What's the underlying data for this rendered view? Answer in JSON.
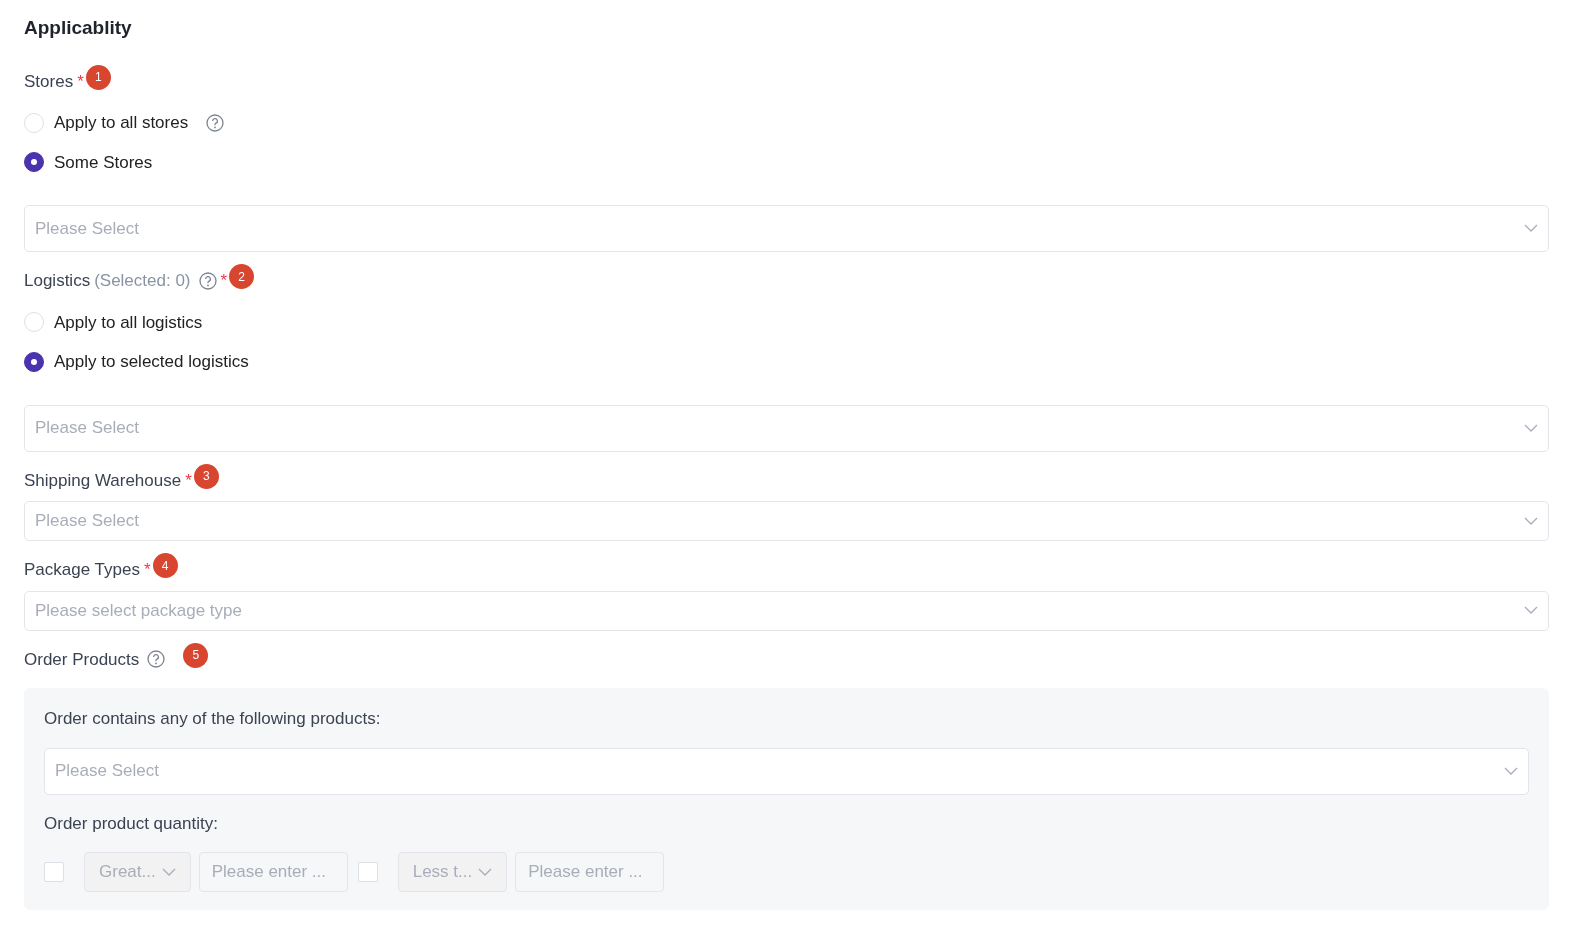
{
  "heading": "Applicablity",
  "sections": [
    {
      "kind": "radios",
      "label": "Stores",
      "help": false,
      "required": "*",
      "badge": "1",
      "options": [
        {
          "label": "Apply to all stores",
          "help": true,
          "selected": false
        },
        {
          "label": "Some Stores",
          "help": false,
          "selected": true
        }
      ],
      "select": {
        "placeholder": "Please Select"
      }
    },
    {
      "kind": "radios",
      "label": "Logistics",
      "note": "(Selected: 0)",
      "help": true,
      "required": "*",
      "badge": "2",
      "options": [
        {
          "label": "Apply to all logistics",
          "help": false,
          "selected": false
        },
        {
          "label": "Apply to selected logistics",
          "help": false,
          "selected": true
        }
      ],
      "select": {
        "placeholder": "Please Select"
      }
    },
    {
      "kind": "select",
      "label": "Shipping Warehouse",
      "help": false,
      "required": "*",
      "badge": "3",
      "select": {
        "placeholder": "Please Select"
      }
    },
    {
      "kind": "select",
      "label": "Package Types",
      "help": false,
      "required": "*",
      "badge": "4",
      "select": {
        "placeholder": "Please select package type"
      }
    },
    {
      "kind": "products",
      "label": "Order Products",
      "help": true,
      "badge": "5",
      "panel": {
        "contains_label": "Order contains any of the following products:",
        "select": {
          "placeholder": "Please Select"
        },
        "quantity_label": "Order product quantity:",
        "conditions": [
          {
            "checked": false,
            "operator": "Great...",
            "disabled": true,
            "placeholder": "Please enter ..."
          },
          {
            "checked": false,
            "operator": "Less t...",
            "disabled": true,
            "placeholder": "Please enter ..."
          }
        ]
      }
    }
  ]
}
